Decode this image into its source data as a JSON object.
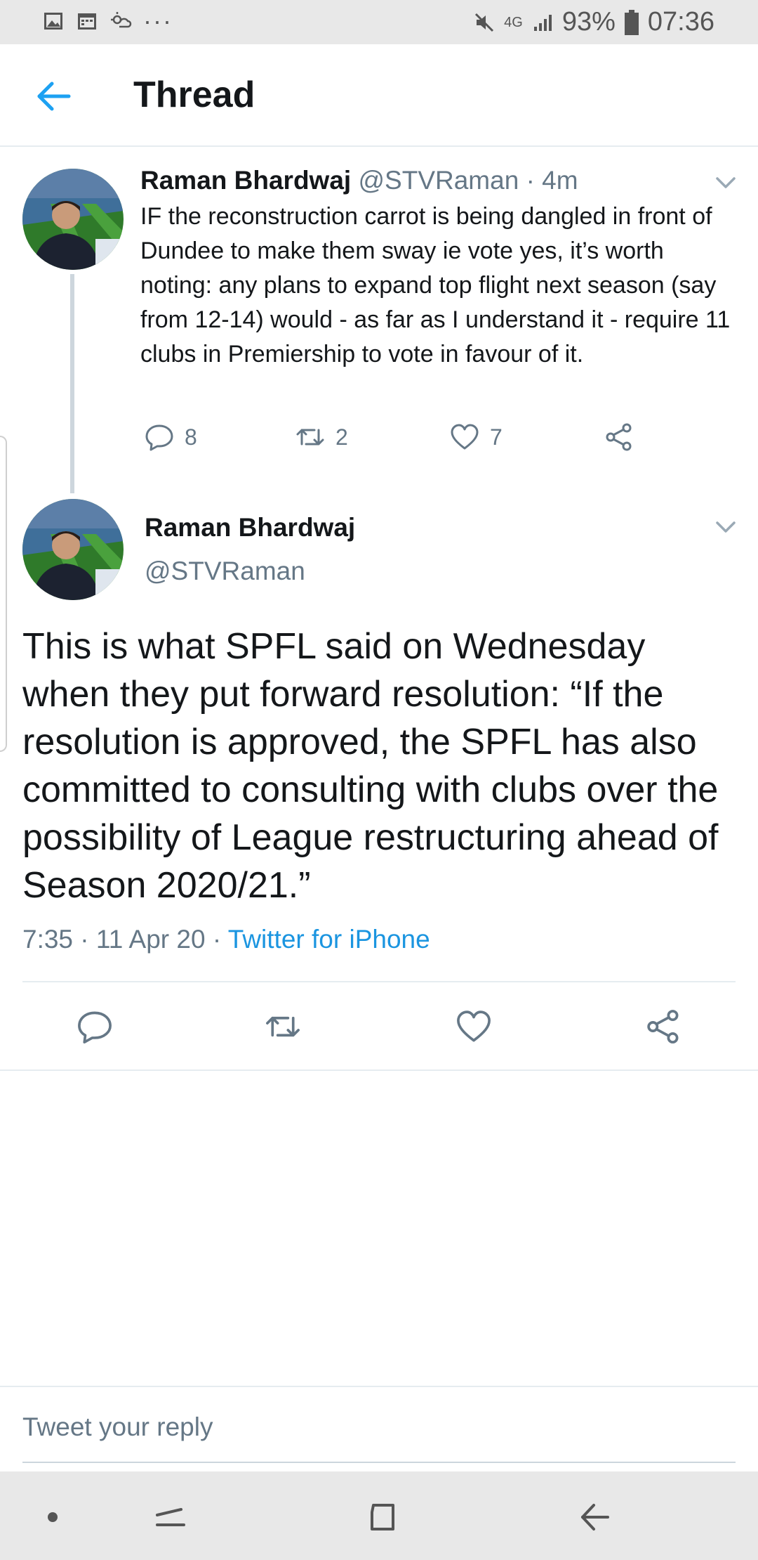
{
  "status_bar": {
    "icons": [
      "image-icon",
      "calendar-icon",
      "weather-icon"
    ],
    "more": "···",
    "network": "4G",
    "battery": "93%",
    "time": "07:36"
  },
  "header": {
    "title": "Thread"
  },
  "tweet1": {
    "name": "Raman Bhardwaj",
    "handle": "@STVRaman",
    "separator": "·",
    "time": "4m",
    "body": "IF the reconstruction carrot is being dangled in front of Dundee to make them sway ie vote yes, it’s worth noting: any plans to expand top flight next season (say from 12-14) would - as far as I understand it - require 11 clubs in Premiership to vote in favour of it.",
    "replies": "8",
    "retweets": "2",
    "likes": "7"
  },
  "tweet2": {
    "name": "Raman Bhardwaj",
    "handle": "@STVRaman",
    "body": "This is what SPFL said on Wednesday when they put forward resolution: “If the resolution is approved, the SPFL has also committed to consulting with clubs over the possibility of League restructuring ahead of Season 2020/21.”",
    "timestamp": "7:35 · 11 Apr 20 · ",
    "source": "Twitter for iPhone"
  },
  "reply": {
    "placeholder": "Tweet your reply"
  },
  "colors": {
    "accent": "#1da1f2",
    "link": "#1b95e0",
    "muted": "#657786",
    "text": "#14171a"
  }
}
